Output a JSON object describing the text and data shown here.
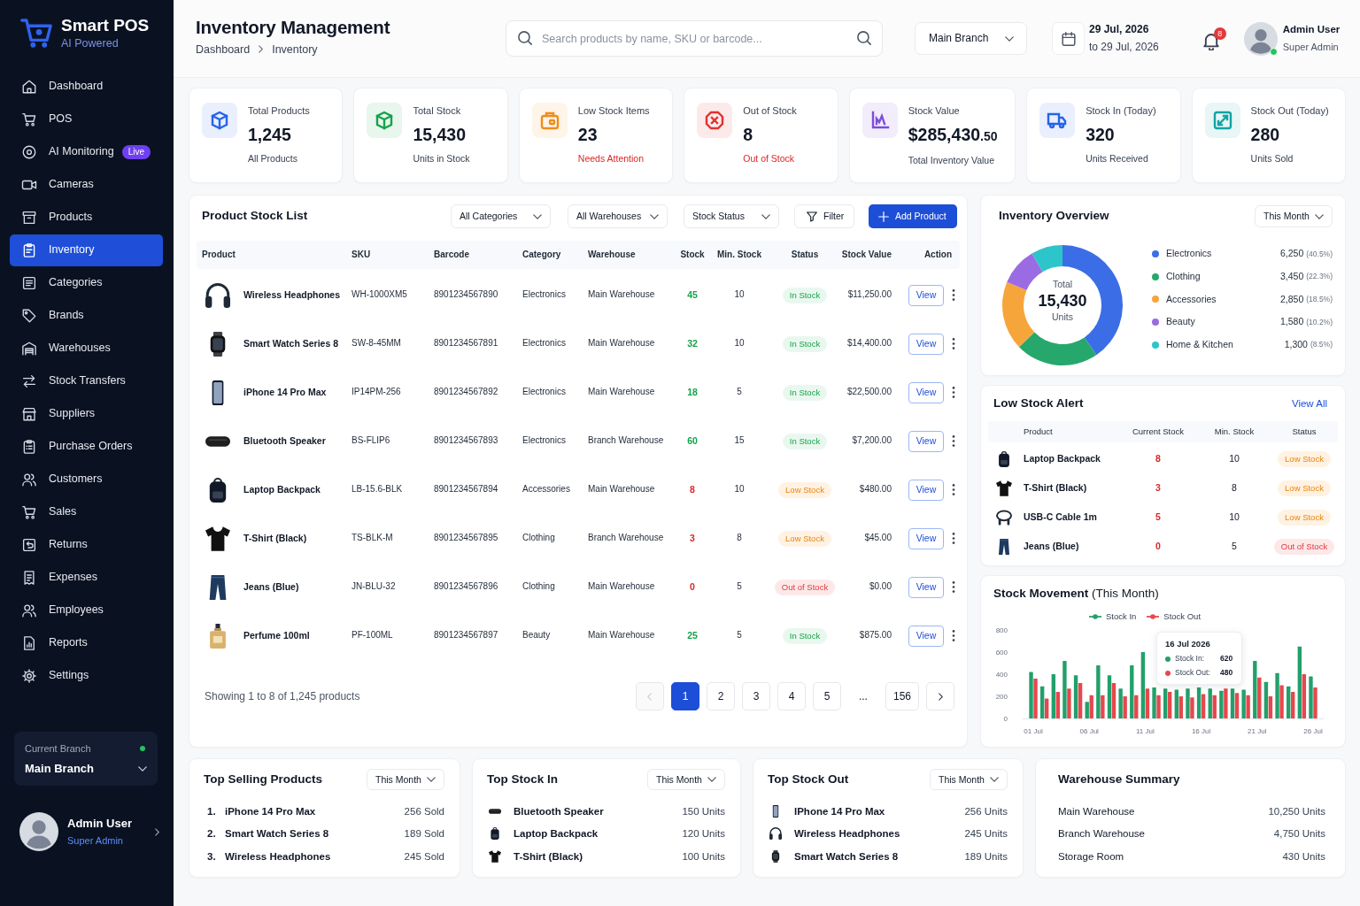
{
  "sidebar": {
    "brand": {
      "name": "Smart POS",
      "tagline": "AI Powered"
    },
    "nav": [
      {
        "label": "Dashboard",
        "selected": false
      },
      {
        "label": "POS",
        "selected": false
      },
      {
        "label": "AI Monitoring",
        "selected": false,
        "badge": "Live"
      },
      {
        "label": "Cameras",
        "selected": false
      },
      {
        "label": "Products",
        "selected": false
      },
      {
        "label": "Inventory",
        "selected": true
      },
      {
        "label": "Categories",
        "selected": false
      },
      {
        "label": "Brands",
        "selected": false
      },
      {
        "label": "Warehouses",
        "selected": false
      },
      {
        "label": "Stock Transfers",
        "selected": false
      },
      {
        "label": "Suppliers",
        "selected": false
      },
      {
        "label": "Purchase Orders",
        "selected": false
      },
      {
        "label": "Customers",
        "selected": false
      },
      {
        "label": "Sales",
        "selected": false
      },
      {
        "label": "Returns",
        "selected": false
      },
      {
        "label": "Expenses",
        "selected": false
      },
      {
        "label": "Employees",
        "selected": false
      },
      {
        "label": "Reports",
        "selected": false
      },
      {
        "label": "Settings",
        "selected": false
      }
    ],
    "branch_card": {
      "label": "Current Branch",
      "value": "Main Branch",
      "online": true
    },
    "user": {
      "name": "Admin User",
      "role": "Super Admin"
    }
  },
  "header": {
    "title": "Inventory Management",
    "breadcrumb": [
      "Dashboard",
      "Inventory"
    ],
    "search": {
      "placeholder": "Search products by name, SKU or barcode..."
    },
    "branch_select": "Main Branch",
    "date_range": {
      "from": "29 Jul, 2026",
      "to": "to 29 Jul, 2026"
    },
    "notification_count": "8",
    "user": {
      "name": "Admin User",
      "role": "Super Admin",
      "online": true
    }
  },
  "stats": [
    {
      "label": "Total Products",
      "value": "1,245",
      "note": "All Products",
      "alert": false,
      "color": "#2563eb"
    },
    {
      "label": "Total Stock",
      "value": "15,430",
      "note": "Units in Stock",
      "alert": false,
      "color": "#16a34a"
    },
    {
      "label": "Low Stock Items",
      "value": "23",
      "note": "Needs Attention",
      "alert": true,
      "color": "#f08c1a"
    },
    {
      "label": "Out of Stock",
      "value": "8",
      "note": "Out of Stock",
      "alert": true,
      "color": "#e03131"
    },
    {
      "label": "Stock Value",
      "value": "$285,430",
      "fraction": ".50",
      "note": "Total Inventory Value",
      "alert": false,
      "color": "#7c4ddb"
    },
    {
      "label": "Stock In (Today)",
      "value": "320",
      "note": "Units Received",
      "alert": false,
      "color": "#2563eb"
    },
    {
      "label": "Stock Out (Today)",
      "value": "280",
      "note": "Units Sold",
      "alert": false,
      "color": "#14a3a3"
    }
  ],
  "product_list": {
    "title": "Product Stock List",
    "filters": [
      "All Categories",
      "All Warehouses",
      "Stock Status"
    ],
    "filter_button": "Filter",
    "add_button": "Add Product",
    "columns": [
      "Product",
      "SKU",
      "Barcode",
      "Category",
      "Warehouse",
      "Stock",
      "Min. Stock",
      "Status",
      "Stock Value",
      "Action"
    ],
    "rows": [
      {
        "kind": "headphones",
        "name": "Wireless Headphones",
        "sku": "WH-1000XM5",
        "barcode": "8901234567890",
        "category": "Electronics",
        "warehouse": "Main Warehouse",
        "stock": "45",
        "min_stock": "10",
        "status": {
          "label": "In Stock",
          "kind": "ok"
        },
        "value": "$11,250.00",
        "action": "View"
      },
      {
        "kind": "watch",
        "name": "Smart Watch Series 8",
        "sku": "SW-8-45MM",
        "barcode": "8901234567891",
        "category": "Electronics",
        "warehouse": "Main Warehouse",
        "stock": "32",
        "min_stock": "10",
        "status": {
          "label": "In Stock",
          "kind": "ok"
        },
        "value": "$14,400.00",
        "action": "View"
      },
      {
        "kind": "phone",
        "name": "iPhone 14 Pro Max",
        "sku": "IP14PM-256",
        "barcode": "8901234567892",
        "category": "Electronics",
        "warehouse": "Main Warehouse",
        "stock": "18",
        "min_stock": "5",
        "status": {
          "label": "In Stock",
          "kind": "ok"
        },
        "value": "$22,500.00",
        "action": "View"
      },
      {
        "kind": "speaker",
        "name": "Bluetooth Speaker",
        "sku": "BS-FLIP6",
        "barcode": "8901234567893",
        "category": "Electronics",
        "warehouse": "Branch Warehouse",
        "stock": "60",
        "min_stock": "15",
        "status": {
          "label": "In Stock",
          "kind": "ok"
        },
        "value": "$7,200.00",
        "action": "View"
      },
      {
        "kind": "backpack",
        "name": "Laptop Backpack",
        "sku": "LB-15.6-BLK",
        "barcode": "8901234567894",
        "category": "Accessories",
        "warehouse": "Main Warehouse",
        "stock": "8",
        "min_stock": "10",
        "status": {
          "label": "Low Stock",
          "kind": "low"
        },
        "value": "$480.00",
        "action": "View"
      },
      {
        "kind": "tshirt",
        "name": "T-Shirt (Black)",
        "sku": "TS-BLK-M",
        "barcode": "8901234567895",
        "category": "Clothing",
        "warehouse": "Branch Warehouse",
        "stock": "3",
        "min_stock": "8",
        "status": {
          "label": "Low Stock",
          "kind": "low"
        },
        "value": "$45.00",
        "action": "View"
      },
      {
        "kind": "jeans",
        "name": "Jeans (Blue)",
        "sku": "JN-BLU-32",
        "barcode": "8901234567896",
        "category": "Clothing",
        "warehouse": "Main Warehouse",
        "stock": "0",
        "min_stock": "5",
        "status": {
          "label": "Out of Stock",
          "kind": "out"
        },
        "value": "$0.00",
        "action": "View"
      },
      {
        "kind": "perfume",
        "name": "Perfume 100ml",
        "sku": "PF-100ML",
        "barcode": "8901234567897",
        "category": "Beauty",
        "warehouse": "Main Warehouse",
        "stock": "25",
        "min_stock": "5",
        "status": {
          "label": "In Stock",
          "kind": "ok"
        },
        "value": "$875.00",
        "action": "View"
      }
    ],
    "pagination": {
      "summary": "Showing 1 to 8 of 1,245 products",
      "prev_disabled": true,
      "next_disabled": false,
      "pages": [
        {
          "label": "1",
          "selected": true
        },
        {
          "label": "2",
          "selected": false
        },
        {
          "label": "3",
          "selected": false
        },
        {
          "label": "4",
          "selected": false
        },
        {
          "label": "5",
          "selected": false
        }
      ],
      "ellipsis": "...",
      "last_page": {
        "label": "156",
        "selected": false
      }
    }
  },
  "inventory_overview": {
    "title": "Inventory Overview",
    "period": "This Month",
    "chart_data": {
      "type": "donut",
      "categories": [
        "Electronics",
        "Clothing",
        "Accessories",
        "Beauty",
        "Home & Kitchen"
      ],
      "values": [
        40.5,
        22.3,
        18.5,
        10.2,
        8.5
      ]
    },
    "center": {
      "label": "Total",
      "value": "15,430",
      "unit": "Units"
    },
    "legend": [
      {
        "value": "6,250",
        "share": "(40.5%)",
        "color": "#3b6ee6"
      },
      {
        "value": "3,450",
        "share": "(22.3%)",
        "color": "#26a86c"
      },
      {
        "value": "2,850",
        "share": "(18.5%)",
        "color": "#f6a53b"
      },
      {
        "value": "1,580",
        "share": "(10.2%)",
        "color": "#9b6be3"
      },
      {
        "value": "1,300",
        "share": "(8.5%)",
        "color": "#2cc5c9"
      }
    ]
  },
  "low_stock_alert": {
    "title": "Low Stock Alert",
    "link": "View All",
    "columns": [
      "Product",
      "Current Stock",
      "Min. Stock",
      "Status"
    ],
    "rows": [
      {
        "kind": "backpack",
        "name": "Laptop Backpack",
        "current": "8",
        "min": "10",
        "status": {
          "label": "Low Stock",
          "kind": "low"
        }
      },
      {
        "kind": "tshirt",
        "name": "T-Shirt (Black)",
        "current": "3",
        "min": "8",
        "status": {
          "label": "Low Stock",
          "kind": "low"
        }
      },
      {
        "kind": "cable",
        "name": "USB-C Cable 1m",
        "current": "5",
        "min": "10",
        "status": {
          "label": "Low Stock",
          "kind": "low"
        }
      },
      {
        "kind": "jeans",
        "name": "Jeans (Blue)",
        "current": "0",
        "min": "5",
        "status": {
          "label": "Out of Stock",
          "kind": "out"
        }
      }
    ]
  },
  "stock_movement": {
    "title": "**Stock Movement** (This Month)",
    "chart_data": {
      "type": "bar",
      "categories": [
        "01 Jul",
        null,
        null,
        null,
        null,
        "06 Jul",
        null,
        null,
        null,
        null,
        "11 Jul",
        null,
        null,
        null,
        null,
        "16 Jul",
        null,
        null,
        null,
        null,
        "21 Jul",
        null,
        null,
        null,
        null,
        "26 Jul"
      ],
      "series": [
        {
          "name": "Stock In",
          "color": "#22a06b",
          "values": [
            420,
            290,
            400,
            520,
            390,
            150,
            480,
            390,
            270,
            480,
            600,
            280,
            270,
            260,
            270,
            280,
            270,
            250,
            270,
            260,
            520,
            330,
            410,
            290,
            650,
            380
          ]
        },
        {
          "name": "Stock Out",
          "color": "#e5484d",
          "values": [
            360,
            180,
            240,
            270,
            320,
            210,
            210,
            320,
            200,
            210,
            270,
            210,
            240,
            200,
            190,
            220,
            210,
            270,
            230,
            210,
            370,
            200,
            300,
            240,
            400,
            280
          ]
        }
      ],
      "ylim": [
        0,
        800
      ],
      "yticks": [
        0,
        200,
        400,
        600,
        800
      ]
    },
    "tooltip": {
      "title": "16 Jul 2026",
      "rows": [
        {
          "label": "Stock In:",
          "value": "620"
        },
        {
          "label": "Stock Out:",
          "value": "480"
        }
      ]
    }
  },
  "top_selling": {
    "title": "Top Selling Products",
    "period": "This Month",
    "items": [
      {
        "rank": "1.",
        "name": "iPhone 14 Pro Max",
        "count": "256 Sold"
      },
      {
        "rank": "2.",
        "name": "Smart Watch Series 8",
        "count": "189 Sold"
      },
      {
        "rank": "3.",
        "name": "Wireless Headphones",
        "count": "245 Sold"
      }
    ]
  },
  "top_stock_in": {
    "title": "Top Stock In",
    "period": "This Month",
    "items": [
      {
        "kind": "speaker",
        "name": "Bluetooth Speaker",
        "count": "150 Units"
      },
      {
        "kind": "backpack",
        "name": "Laptop Backpack",
        "count": "120 Units"
      },
      {
        "kind": "tshirt",
        "name": "T-Shirt (Black)",
        "count": "100 Units"
      }
    ]
  },
  "top_stock_out": {
    "title": "Top Stock Out",
    "period": "This Month",
    "items": [
      {
        "kind": "phone",
        "name": "IPhone 14 Pro Max",
        "count": "256 Units"
      },
      {
        "kind": "headphones",
        "name": "Wireless Headphones",
        "count": "245 Units"
      },
      {
        "kind": "watch",
        "name": "Smart Watch Series 8",
        "count": "189 Units"
      }
    ]
  },
  "warehouse_summary": {
    "title": "Warehouse Summary",
    "items": [
      {
        "name": "Main Warehouse",
        "count": "10,250 Units"
      },
      {
        "name": "Branch Warehouse",
        "count": "4,750 Units"
      },
      {
        "name": "Storage Room",
        "count": "430 Units"
      }
    ]
  }
}
